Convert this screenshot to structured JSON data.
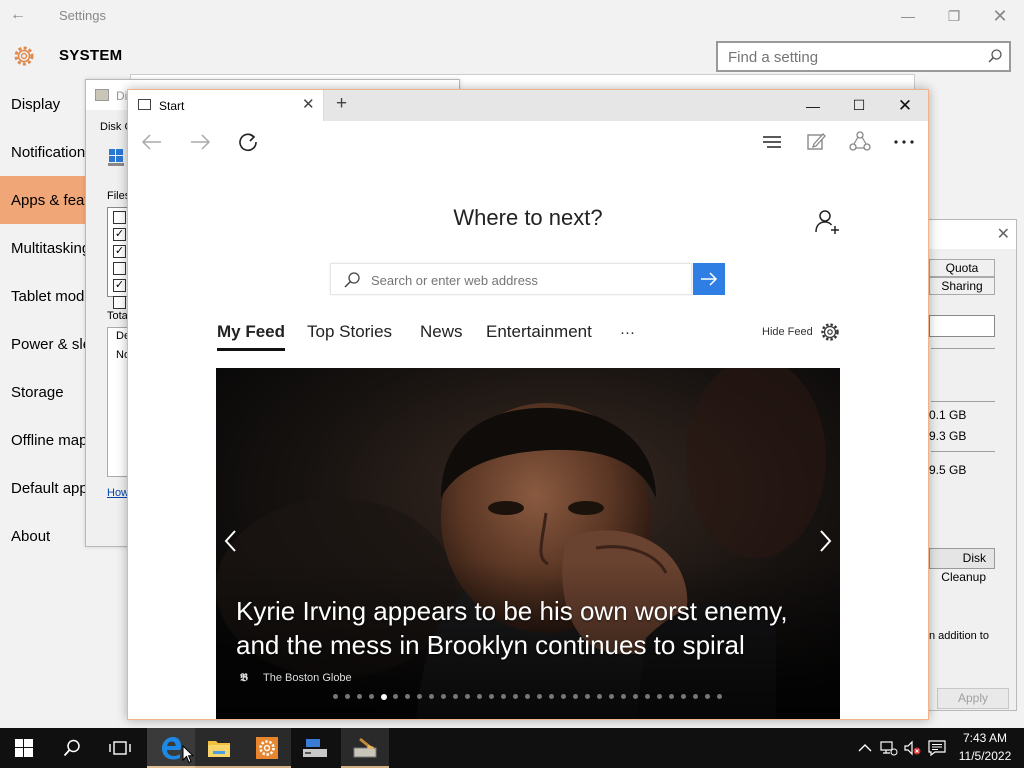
{
  "settings": {
    "title": "Settings",
    "section": "SYSTEM",
    "search_placeholder": "Find a setting",
    "nav": [
      {
        "label": "Display"
      },
      {
        "label": "Notifications"
      },
      {
        "label": "Apps & features"
      },
      {
        "label": "Multitasking"
      },
      {
        "label": "Tablet mode"
      },
      {
        "label": "Power & sleep"
      },
      {
        "label": "Storage"
      },
      {
        "label": "Offline maps"
      },
      {
        "label": "Default apps"
      },
      {
        "label": "About"
      }
    ],
    "active_nav": "Apps & features"
  },
  "disk_cleanup": {
    "title": "Di",
    "subtitle": "Disk C",
    "files_label": "Files",
    "total_label": "Tota",
    "desc_de": "De",
    "desc_no": "No",
    "link": "How",
    "checkboxes": [
      false,
      true,
      true,
      false,
      true,
      false
    ]
  },
  "properties": {
    "tabs": [
      "Quota",
      "Sharing"
    ],
    "sizes": [
      "0.1 GB",
      "9.3 GB",
      "9.5 GB"
    ],
    "cleanup_button": "Disk Cleanup",
    "addition_text": "n addition to",
    "apply_button": "Apply"
  },
  "edge": {
    "tab_title": "Start",
    "heading": "Where to next?",
    "search_placeholder": "Search or enter web address",
    "feed_tabs": [
      "My Feed",
      "Top Stories",
      "News",
      "Entertainment"
    ],
    "more_label": "···",
    "hide_feed": "Hide Feed",
    "hero": {
      "headline": "Kyrie Irving appears to be his own worst enemy, and the mess in Brooklyn continues to spiral",
      "source_icon": "𝕭",
      "source": "The Boston Globe",
      "slide_count": 33,
      "current_slide": 5
    }
  },
  "taskbar": {
    "time": "7:43 AM",
    "date": "11/5/2022",
    "apps": [
      "start-icon",
      "search-icon",
      "task-view-icon",
      "edge-icon",
      "file-explorer-icon",
      "settings-icon",
      "server-manager-icon",
      "disk-cleanup-icon"
    ]
  },
  "colors": {
    "accent": "#f0a676",
    "edge_blue": "#2f7ee4",
    "taskbar": "#101010"
  }
}
